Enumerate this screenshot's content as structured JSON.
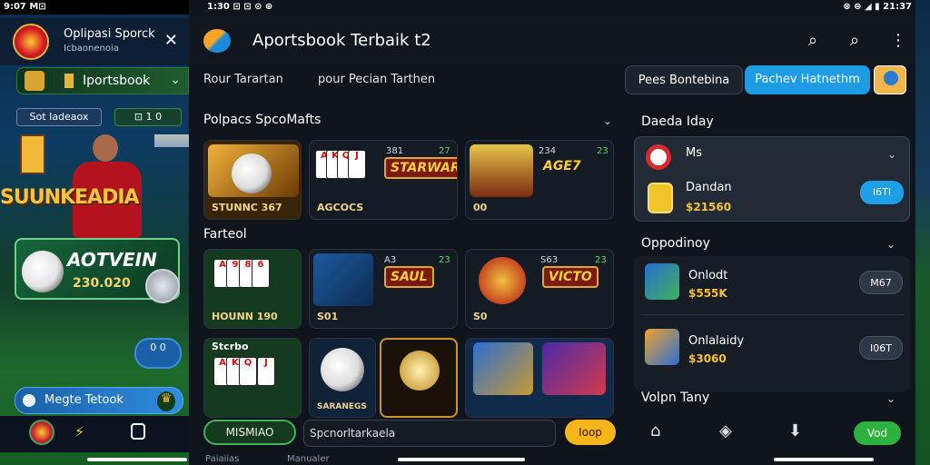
{
  "left_phone": {
    "status_time": "9:07",
    "status_icons": "M⊡",
    "app_title": "Oplipasi Sporck",
    "app_subtitle": "Icbaonenoia",
    "nav_label": "Iportsbook",
    "pill_left": "Sot Iadeaox",
    "pill_right": "⊡ 1 0",
    "big_text": "SUUNKEADIA",
    "card_title": "AOTVEIN",
    "card_value": "230.020",
    "badge_text": "0 0",
    "bottom_label": "Megte Tetook"
  },
  "status": {
    "left": "1:30 ⊡ ⊡ ⊙ ⊕",
    "right": "⊗ ⊜ ◢ ▮ 21:37"
  },
  "header": {
    "title": "Aportsbook Terbaik t2"
  },
  "tabs": {
    "tab1": "Rour Tarartan",
    "tab2": "pour Pecian Tarthen",
    "pill_dark": "Pees Bontebina",
    "pill_blue": "Pachev Hatnethm"
  },
  "games": {
    "section1": "Polpacs SpcoMafts",
    "section2": "Farteol",
    "tiles": [
      {
        "label": "STUNNC 367",
        "num": "",
        "num2": ""
      },
      {
        "label": "AGCOCS",
        "num": "381",
        "num2": "27",
        "logo": "STARWAR"
      },
      {
        "label": "00",
        "num": "234",
        "num2": "23",
        "logo": "AGE7"
      },
      {
        "label": "HOUNN 190",
        "num": "",
        "num2": ""
      },
      {
        "label": "S01",
        "num": "A3",
        "num2": "23",
        "logo": "SAUL"
      },
      {
        "label": "S0",
        "num": "S63",
        "num2": "23",
        "logo": "VICTO"
      },
      {
        "label": "",
        "num": "",
        "num2": ""
      },
      {
        "label": "SARANEGS",
        "num": "",
        "num2": ""
      },
      {
        "label": "",
        "num": "",
        "num2": ""
      },
      {
        "label": "",
        "num": "",
        "num2": ""
      }
    ],
    "tile7_title": "Stcrbo"
  },
  "bottom": {
    "btn": "MISMIAO",
    "input_value": "Spcnorltarkaela",
    "go": "Ioop",
    "under1": "Paiaiias",
    "under2": "Manualer"
  },
  "side": {
    "title1": "Daeda Iday",
    "featured": {
      "name1": "Ms",
      "name2": "Dandan",
      "amount": "$21560",
      "btn": "I6TI"
    },
    "title2": "Oppodinoy",
    "row1": {
      "name": "Onlodt",
      "amount": "$555K",
      "btn": "M67"
    },
    "row2": {
      "name": "Onlalaidy",
      "amount": "$3060",
      "btn": "I06T"
    },
    "title3": "Volpn Tany",
    "nav_go": "Vod"
  },
  "colors": {
    "accent_blue": "#1e9be5",
    "accent_green": "#2cb13e",
    "accent_gold": "#f6b51b"
  }
}
